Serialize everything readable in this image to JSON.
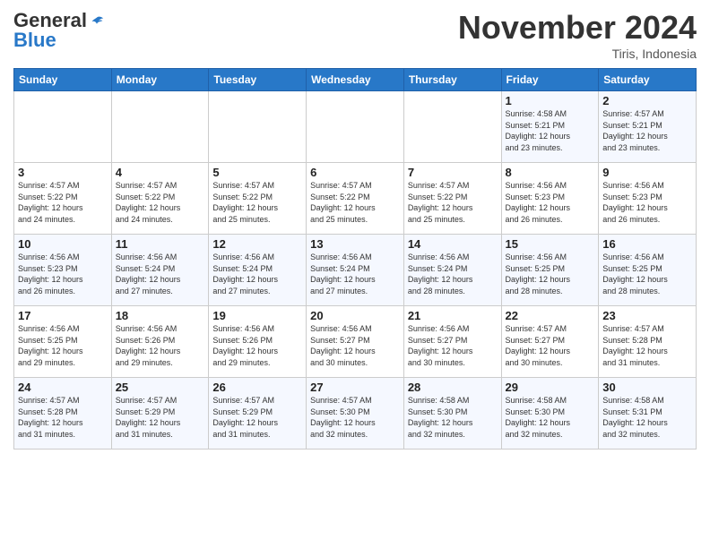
{
  "header": {
    "logo_general": "General",
    "logo_blue": "Blue",
    "month_title": "November 2024",
    "location": "Tiris, Indonesia"
  },
  "weekdays": [
    "Sunday",
    "Monday",
    "Tuesday",
    "Wednesday",
    "Thursday",
    "Friday",
    "Saturday"
  ],
  "weeks": [
    [
      {
        "day": "",
        "info": ""
      },
      {
        "day": "",
        "info": ""
      },
      {
        "day": "",
        "info": ""
      },
      {
        "day": "",
        "info": ""
      },
      {
        "day": "",
        "info": ""
      },
      {
        "day": "1",
        "info": "Sunrise: 4:58 AM\nSunset: 5:21 PM\nDaylight: 12 hours\nand 23 minutes."
      },
      {
        "day": "2",
        "info": "Sunrise: 4:57 AM\nSunset: 5:21 PM\nDaylight: 12 hours\nand 23 minutes."
      }
    ],
    [
      {
        "day": "3",
        "info": "Sunrise: 4:57 AM\nSunset: 5:22 PM\nDaylight: 12 hours\nand 24 minutes."
      },
      {
        "day": "4",
        "info": "Sunrise: 4:57 AM\nSunset: 5:22 PM\nDaylight: 12 hours\nand 24 minutes."
      },
      {
        "day": "5",
        "info": "Sunrise: 4:57 AM\nSunset: 5:22 PM\nDaylight: 12 hours\nand 25 minutes."
      },
      {
        "day": "6",
        "info": "Sunrise: 4:57 AM\nSunset: 5:22 PM\nDaylight: 12 hours\nand 25 minutes."
      },
      {
        "day": "7",
        "info": "Sunrise: 4:57 AM\nSunset: 5:22 PM\nDaylight: 12 hours\nand 25 minutes."
      },
      {
        "day": "8",
        "info": "Sunrise: 4:56 AM\nSunset: 5:23 PM\nDaylight: 12 hours\nand 26 minutes."
      },
      {
        "day": "9",
        "info": "Sunrise: 4:56 AM\nSunset: 5:23 PM\nDaylight: 12 hours\nand 26 minutes."
      }
    ],
    [
      {
        "day": "10",
        "info": "Sunrise: 4:56 AM\nSunset: 5:23 PM\nDaylight: 12 hours\nand 26 minutes."
      },
      {
        "day": "11",
        "info": "Sunrise: 4:56 AM\nSunset: 5:24 PM\nDaylight: 12 hours\nand 27 minutes."
      },
      {
        "day": "12",
        "info": "Sunrise: 4:56 AM\nSunset: 5:24 PM\nDaylight: 12 hours\nand 27 minutes."
      },
      {
        "day": "13",
        "info": "Sunrise: 4:56 AM\nSunset: 5:24 PM\nDaylight: 12 hours\nand 27 minutes."
      },
      {
        "day": "14",
        "info": "Sunrise: 4:56 AM\nSunset: 5:24 PM\nDaylight: 12 hours\nand 28 minutes."
      },
      {
        "day": "15",
        "info": "Sunrise: 4:56 AM\nSunset: 5:25 PM\nDaylight: 12 hours\nand 28 minutes."
      },
      {
        "day": "16",
        "info": "Sunrise: 4:56 AM\nSunset: 5:25 PM\nDaylight: 12 hours\nand 28 minutes."
      }
    ],
    [
      {
        "day": "17",
        "info": "Sunrise: 4:56 AM\nSunset: 5:25 PM\nDaylight: 12 hours\nand 29 minutes."
      },
      {
        "day": "18",
        "info": "Sunrise: 4:56 AM\nSunset: 5:26 PM\nDaylight: 12 hours\nand 29 minutes."
      },
      {
        "day": "19",
        "info": "Sunrise: 4:56 AM\nSunset: 5:26 PM\nDaylight: 12 hours\nand 29 minutes."
      },
      {
        "day": "20",
        "info": "Sunrise: 4:56 AM\nSunset: 5:27 PM\nDaylight: 12 hours\nand 30 minutes."
      },
      {
        "day": "21",
        "info": "Sunrise: 4:56 AM\nSunset: 5:27 PM\nDaylight: 12 hours\nand 30 minutes."
      },
      {
        "day": "22",
        "info": "Sunrise: 4:57 AM\nSunset: 5:27 PM\nDaylight: 12 hours\nand 30 minutes."
      },
      {
        "day": "23",
        "info": "Sunrise: 4:57 AM\nSunset: 5:28 PM\nDaylight: 12 hours\nand 31 minutes."
      }
    ],
    [
      {
        "day": "24",
        "info": "Sunrise: 4:57 AM\nSunset: 5:28 PM\nDaylight: 12 hours\nand 31 minutes."
      },
      {
        "day": "25",
        "info": "Sunrise: 4:57 AM\nSunset: 5:29 PM\nDaylight: 12 hours\nand 31 minutes."
      },
      {
        "day": "26",
        "info": "Sunrise: 4:57 AM\nSunset: 5:29 PM\nDaylight: 12 hours\nand 31 minutes."
      },
      {
        "day": "27",
        "info": "Sunrise: 4:57 AM\nSunset: 5:30 PM\nDaylight: 12 hours\nand 32 minutes."
      },
      {
        "day": "28",
        "info": "Sunrise: 4:58 AM\nSunset: 5:30 PM\nDaylight: 12 hours\nand 32 minutes."
      },
      {
        "day": "29",
        "info": "Sunrise: 4:58 AM\nSunset: 5:30 PM\nDaylight: 12 hours\nand 32 minutes."
      },
      {
        "day": "30",
        "info": "Sunrise: 4:58 AM\nSunset: 5:31 PM\nDaylight: 12 hours\nand 32 minutes."
      }
    ]
  ]
}
